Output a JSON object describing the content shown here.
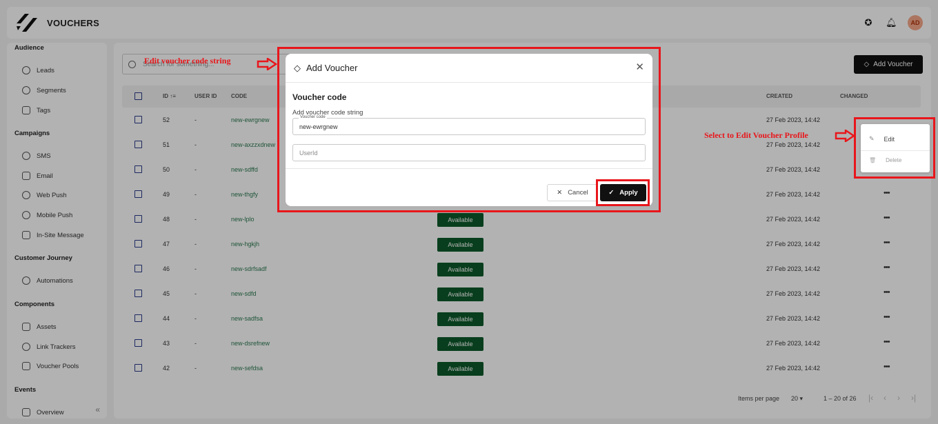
{
  "app": {
    "title": "VOUCHERS",
    "avatar_initials": "AD"
  },
  "header": {
    "icons": [
      "support-icon",
      "bell-icon"
    ]
  },
  "sidebar": {
    "sections": [
      {
        "label": "Audience",
        "items": [
          {
            "label": "Leads",
            "icon": "users-icon"
          },
          {
            "label": "Segments",
            "icon": "pie-icon"
          },
          {
            "label": "Tags",
            "icon": "tag-icon"
          }
        ]
      },
      {
        "label": "Campaigns",
        "items": [
          {
            "label": "SMS",
            "icon": "chat-icon"
          },
          {
            "label": "Email",
            "icon": "mail-icon"
          },
          {
            "label": "Web Push",
            "icon": "bell-icon"
          },
          {
            "label": "Mobile Push",
            "icon": "mobile-icon"
          },
          {
            "label": "In-Site Message",
            "icon": "message-icon"
          }
        ]
      },
      {
        "label": "Customer Journey",
        "items": [
          {
            "label": "Automations",
            "icon": "rocket-icon"
          }
        ]
      },
      {
        "label": "Components",
        "items": [
          {
            "label": "Assets",
            "icon": "database-icon"
          },
          {
            "label": "Link Trackers",
            "icon": "link-icon"
          },
          {
            "label": "Voucher Pools",
            "icon": "ticket-icon"
          }
        ]
      },
      {
        "label": "Events",
        "items": [
          {
            "label": "Overview",
            "icon": "chart-icon"
          }
        ]
      }
    ]
  },
  "toolbar": {
    "search_placeholder": "Search for something...",
    "add_label": "Add Voucher"
  },
  "table": {
    "headers": {
      "id": "ID",
      "user_id": "USER ID",
      "code": "CODE",
      "created": "CREATED",
      "changed": "CHANGED"
    },
    "rows": [
      {
        "id": "52",
        "user": "-",
        "code": "new-ewrgnew",
        "status": "",
        "created": "27 Feb 2023, 14:42"
      },
      {
        "id": "51",
        "user": "-",
        "code": "new-axzzxdnew",
        "status": "",
        "created": "27 Feb 2023, 14:42"
      },
      {
        "id": "50",
        "user": "-",
        "code": "new-sdffd",
        "status": "",
        "created": "27 Feb 2023, 14:42"
      },
      {
        "id": "49",
        "user": "-",
        "code": "new-thgfy",
        "status": "",
        "created": "27 Feb 2023, 14:42"
      },
      {
        "id": "48",
        "user": "-",
        "code": "new-lplo",
        "status": "Available",
        "created": "27 Feb 2023, 14:42"
      },
      {
        "id": "47",
        "user": "-",
        "code": "new-hgkjh",
        "status": "Available",
        "created": "27 Feb 2023, 14:42"
      },
      {
        "id": "46",
        "user": "-",
        "code": "new-sdrfsadf",
        "status": "Available",
        "created": "27 Feb 2023, 14:42"
      },
      {
        "id": "45",
        "user": "-",
        "code": "new-sdfd",
        "status": "Available",
        "created": "27 Feb 2023, 14:42"
      },
      {
        "id": "44",
        "user": "-",
        "code": "new-sadfsa",
        "status": "Available",
        "created": "27 Feb 2023, 14:42"
      },
      {
        "id": "43",
        "user": "-",
        "code": "new-dsrefnew",
        "status": "Available",
        "created": "27 Feb 2023, 14:42"
      },
      {
        "id": "42",
        "user": "-",
        "code": "new-sefdsa",
        "status": "Available",
        "created": "27 Feb 2023, 14:42"
      }
    ]
  },
  "footer": {
    "items_per_page_label": "Items per page",
    "page_size": "20",
    "range": "1 – 20 of 26"
  },
  "modal": {
    "title": "Add Voucher",
    "section_title": "Voucher code",
    "help_text": "Add voucher code string",
    "code_legend": "Voucher code",
    "code_value": "new-ewrgnew",
    "userid_placeholder": "UserId",
    "cancel_label": "Cancel",
    "apply_label": "Apply"
  },
  "context_menu": {
    "edit_label": "Edit",
    "delete_label": "Delete"
  },
  "annotations": {
    "edit_code": "Edit voucher code string",
    "edit_profile": "Select to Edit Voucher Profile",
    "color": "#e8161b"
  }
}
